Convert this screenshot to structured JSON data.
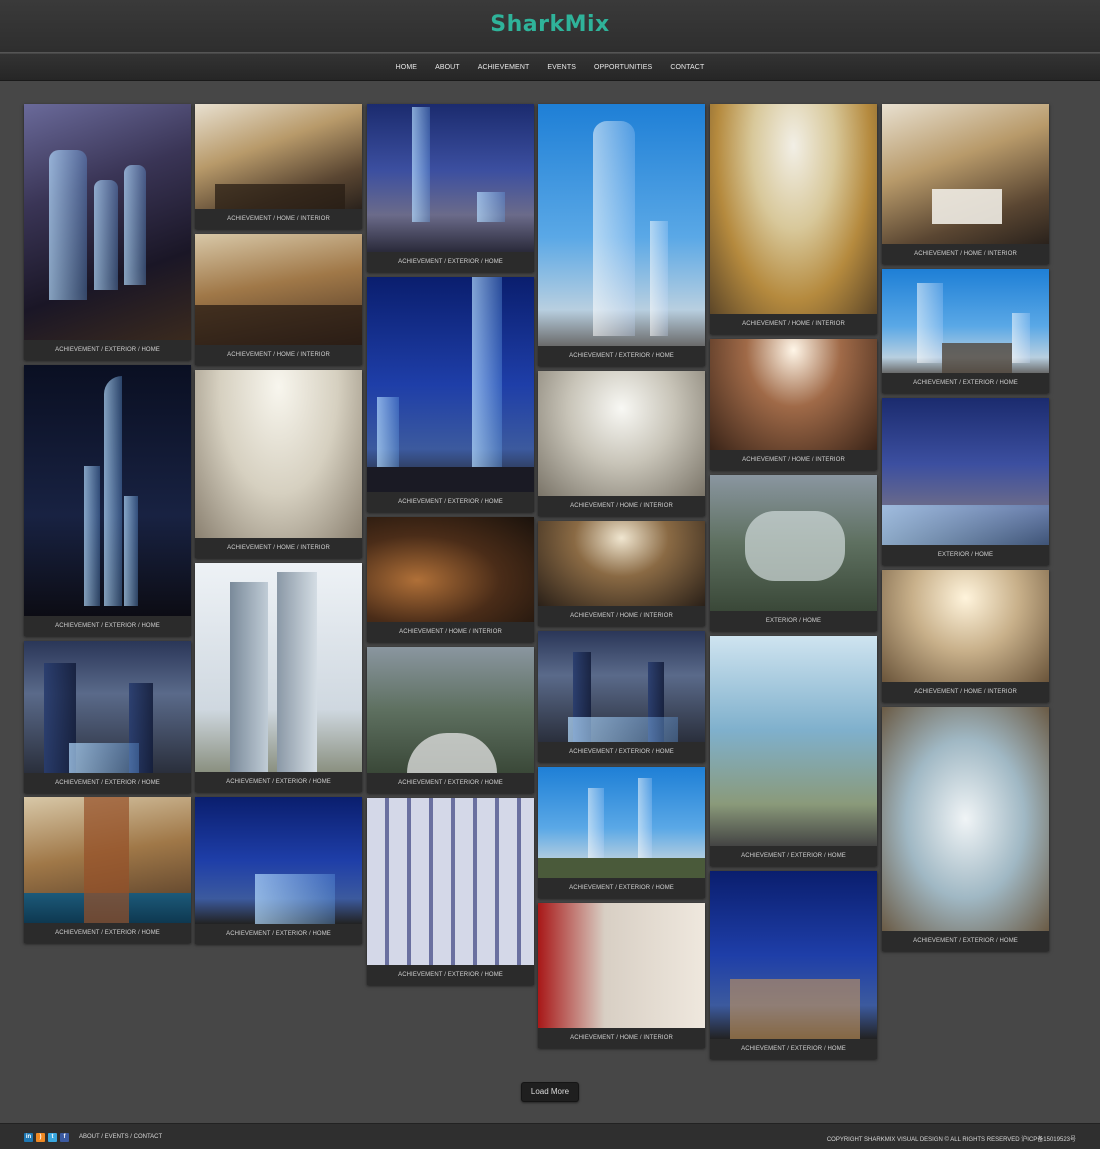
{
  "brand": {
    "logo": "SharkMix",
    "accent": "#2fb39a"
  },
  "nav": [
    "HOME",
    "ABOUT",
    "ACHIEVEMENT",
    "EVENTS",
    "OPPORTUNITIES",
    "CONTACT"
  ],
  "gallery": [
    {
      "caption": "ACHIEVEMENT / EXTERIOR / HOME"
    },
    {
      "caption": "ACHIEVEMENT / EXTERIOR / HOME"
    },
    {
      "caption": "ACHIEVEMENT / EXTERIOR / HOME"
    },
    {
      "caption": "ACHIEVEMENT / EXTERIOR / HOME"
    },
    {
      "caption": "ACHIEVEMENT / HOME / INTERIOR"
    },
    {
      "caption": "ACHIEVEMENT / HOME / INTERIOR"
    },
    {
      "caption": "ACHIEVEMENT / HOME / INTERIOR"
    },
    {
      "caption": "ACHIEVEMENT / EXTERIOR / HOME"
    },
    {
      "caption": "ACHIEVEMENT / EXTERIOR / HOME"
    },
    {
      "caption": "ACHIEVEMENT / EXTERIOR / HOME"
    },
    {
      "caption": "ACHIEVEMENT / EXTERIOR / HOME"
    },
    {
      "caption": "ACHIEVEMENT / HOME / INTERIOR"
    },
    {
      "caption": "ACHIEVEMENT / EXTERIOR / HOME"
    },
    {
      "caption": "ACHIEVEMENT / EXTERIOR / HOME"
    },
    {
      "caption": "ACHIEVEMENT / EXTERIOR / HOME"
    },
    {
      "caption": "ACHIEVEMENT / HOME / INTERIOR"
    },
    {
      "caption": "ACHIEVEMENT / HOME / INTERIOR"
    },
    {
      "caption": "ACHIEVEMENT / EXTERIOR / HOME"
    },
    {
      "caption": "ACHIEVEMENT / EXTERIOR / HOME"
    },
    {
      "caption": "ACHIEVEMENT / HOME / INTERIOR"
    },
    {
      "caption": "ACHIEVEMENT / HOME / INTERIOR"
    },
    {
      "caption": "ACHIEVEMENT / HOME / INTERIOR"
    },
    {
      "caption": "EXTERIOR / HOME"
    },
    {
      "caption": "ACHIEVEMENT / EXTERIOR / HOME"
    },
    {
      "caption": "ACHIEVEMENT / EXTERIOR / HOME"
    },
    {
      "caption": "ACHIEVEMENT / HOME / INTERIOR"
    },
    {
      "caption": "ACHIEVEMENT / EXTERIOR / HOME"
    },
    {
      "caption": "EXTERIOR / HOME"
    },
    {
      "caption": "ACHIEVEMENT / HOME / INTERIOR"
    },
    {
      "caption": "ACHIEVEMENT / EXTERIOR / HOME"
    }
  ],
  "load_more": "Load More",
  "footer": {
    "social_icons": [
      "linkedin-icon",
      "rss-icon",
      "twitter-icon",
      "facebook-icon"
    ],
    "links": [
      "ABOUT",
      "EVENTS",
      "CONTACT"
    ],
    "separator": "/",
    "copyright": "COPYRIGHT SHARKMIX VISUAL DESIGN © ALL RIGHTS RESERVED 沪ICP备15019523号"
  }
}
